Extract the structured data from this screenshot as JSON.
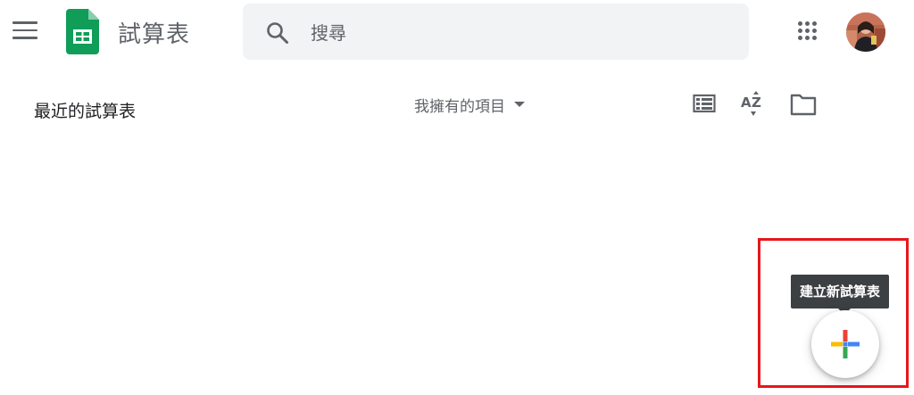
{
  "header": {
    "app_title": "試算表",
    "menu_icon": "hamburger-menu-icon",
    "logo_icon": "google-sheets-logo-icon",
    "search": {
      "placeholder": "搜尋",
      "value": ""
    },
    "apps_icon": "google-apps-grid-icon",
    "avatar": "user-avatar"
  },
  "toolbar": {
    "section_title": "最近的試算表",
    "owner_filter": "我擁有的項目",
    "icons": [
      "list-view-icon",
      "sort-az-icon",
      "folder-icon"
    ]
  },
  "fab": {
    "tooltip": "建立新試算表",
    "icon": "plus-multicolor-icon"
  },
  "colors": {
    "sheets_green": "#0f9d58",
    "highlight_red": "#e8161a",
    "plus_red": "#ea4335",
    "plus_blue": "#4285f4",
    "plus_yellow": "#fbbc04",
    "plus_green": "#34a853"
  }
}
